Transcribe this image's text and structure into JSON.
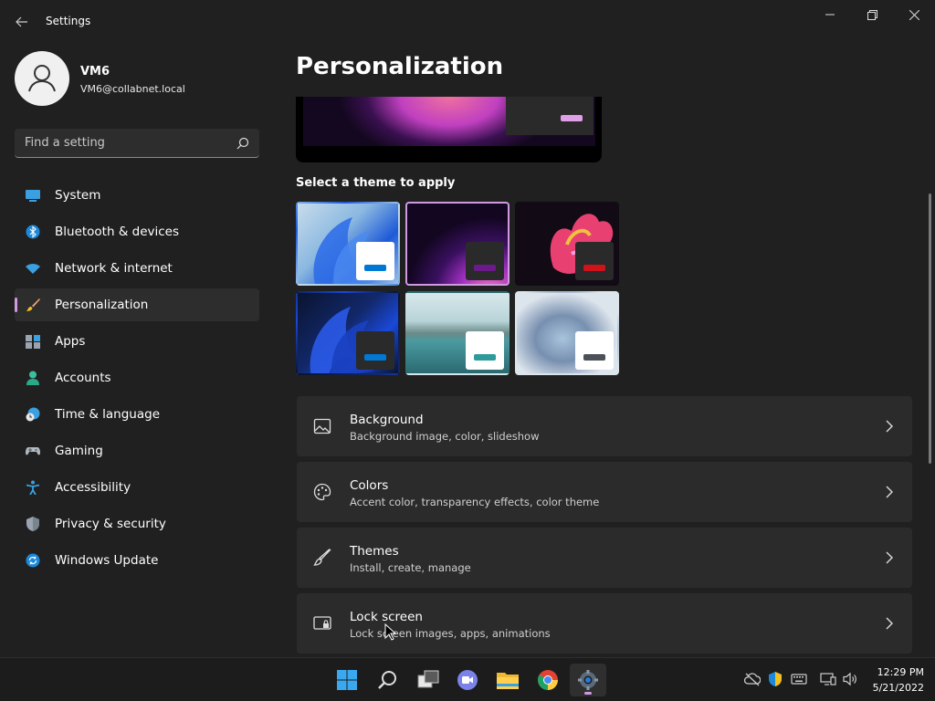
{
  "window": {
    "app_title": "Settings",
    "back_icon": "back-arrow-icon",
    "controls": [
      "minimize-icon",
      "restore-icon",
      "close-icon"
    ]
  },
  "profile": {
    "name": "VM6",
    "email": "VM6@collabnet.local"
  },
  "search": {
    "placeholder": "Find a setting"
  },
  "sidebar": {
    "items": [
      {
        "label": "System",
        "icon": "system-icon",
        "active": false
      },
      {
        "label": "Bluetooth & devices",
        "icon": "bluetooth-icon",
        "active": false
      },
      {
        "label": "Network & internet",
        "icon": "wifi-icon",
        "active": false
      },
      {
        "label": "Personalization",
        "icon": "brush-icon",
        "active": true
      },
      {
        "label": "Apps",
        "icon": "apps-icon",
        "active": false
      },
      {
        "label": "Accounts",
        "icon": "accounts-icon",
        "active": false
      },
      {
        "label": "Time & language",
        "icon": "time-language-icon",
        "active": false
      },
      {
        "label": "Gaming",
        "icon": "gamepad-icon",
        "active": false
      },
      {
        "label": "Accessibility",
        "icon": "accessibility-icon",
        "active": false
      },
      {
        "label": "Privacy & security",
        "icon": "shield-icon",
        "active": false
      },
      {
        "label": "Windows Update",
        "icon": "update-icon",
        "active": false
      }
    ]
  },
  "main": {
    "title": "Personalization",
    "themes_heading": "Select a theme to apply",
    "themes": [
      {
        "name": "windows-light",
        "accent": "#0078d4",
        "selected": false
      },
      {
        "name": "glow",
        "accent": "#6b1a8a",
        "selected": true
      },
      {
        "name": "captured-motion",
        "accent": "#d0121b",
        "selected": false
      },
      {
        "name": "windows-dark",
        "accent": "#0078d4",
        "selected": false
      },
      {
        "name": "sunrise",
        "accent": "#2e9a9a",
        "selected": false
      },
      {
        "name": "flow",
        "accent": "#4c5058",
        "selected": false
      }
    ],
    "cards": [
      {
        "title": "Background",
        "subtitle": "Background image, color, slideshow",
        "icon": "image-icon"
      },
      {
        "title": "Colors",
        "subtitle": "Accent color, transparency effects, color theme",
        "icon": "palette-icon"
      },
      {
        "title": "Themes",
        "subtitle": "Install, create, manage",
        "icon": "brush-icon"
      },
      {
        "title": "Lock screen",
        "subtitle": "Lock screen images, apps, animations",
        "icon": "lock-screen-icon"
      }
    ]
  },
  "taskbar": {
    "apps": [
      "start-icon",
      "search-icon",
      "task-view-icon",
      "teams-chat-icon",
      "file-explorer-icon",
      "chrome-icon",
      "settings-icon"
    ],
    "active_app": "settings-icon",
    "tray": [
      "onedrive-icon",
      "defender-icon",
      "keyboard-icon",
      "display-icon",
      "volume-icon"
    ],
    "time": "12:29 PM",
    "date": "5/21/2022"
  },
  "colors": {
    "accent": "#d09ae0",
    "background": "#202020",
    "card": "#2b2b2b"
  }
}
